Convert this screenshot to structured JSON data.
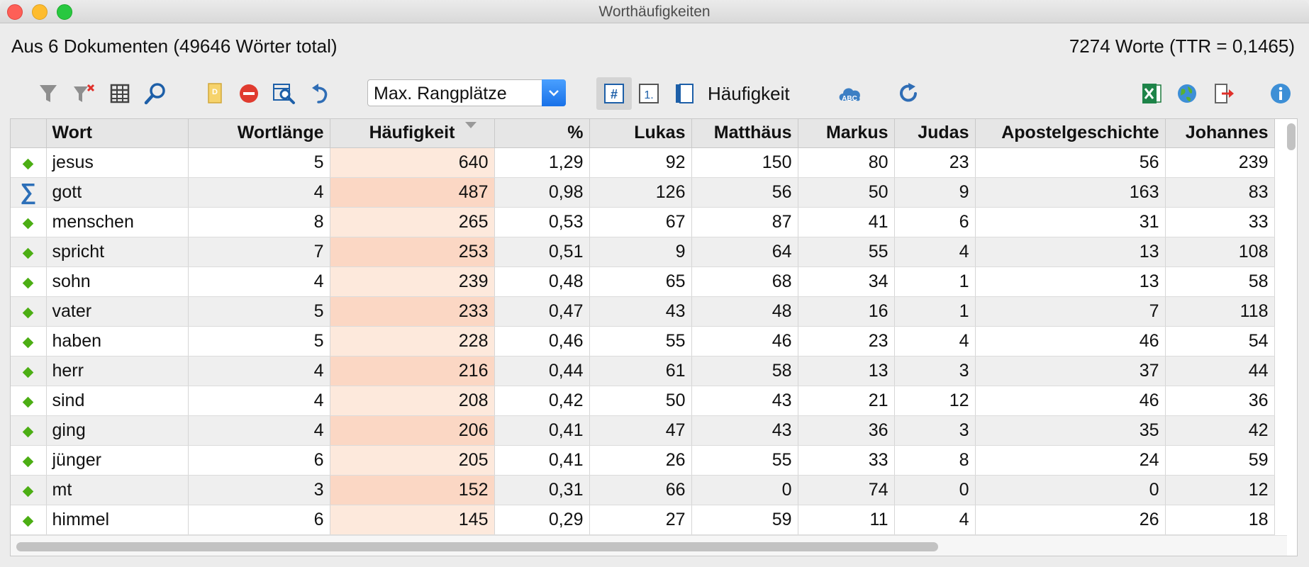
{
  "window": {
    "title": "Worthäufigkeiten"
  },
  "summary": {
    "documents": "Aus 6 Dokumenten (49646 Wörter total)",
    "words": "7274 Worte (TTR = 0,1465)"
  },
  "toolbar": {
    "left_icons": [
      "filter-icon",
      "clear-filter-icon",
      "columns-icon",
      "search-icon",
      "dictionary-icon",
      "stoplist-icon",
      "search-results-icon",
      "undo-icon"
    ],
    "rank_dropdown": {
      "selected": "Max. Rangplätze"
    },
    "view_icons": [
      "frequency-hash-icon",
      "rank-icon",
      "document-icon"
    ],
    "sort_label": "Häufigkeit",
    "right_icons": [
      "word-cloud-icon",
      "refresh-icon",
      "excel-export-icon",
      "web-export-icon",
      "export-icon",
      "info-icon"
    ]
  },
  "table": {
    "columns": [
      "Wort",
      "Wortlänge",
      "Häufigkeit",
      "%",
      "Lukas",
      "Matthäus",
      "Markus",
      "Judas",
      "Apostelgeschichte",
      "Johannes"
    ],
    "sorted_by": "Häufigkeit",
    "rows": [
      {
        "marker": "diamond",
        "cells": [
          "jesus",
          "5",
          "640",
          "1,29",
          "92",
          "150",
          "80",
          "23",
          "56",
          "239"
        ]
      },
      {
        "marker": "sigma",
        "cells": [
          "gott",
          "4",
          "487",
          "0,98",
          "126",
          "56",
          "50",
          "9",
          "163",
          "83"
        ]
      },
      {
        "marker": "diamond",
        "cells": [
          "menschen",
          "8",
          "265",
          "0,53",
          "67",
          "87",
          "41",
          "6",
          "31",
          "33"
        ]
      },
      {
        "marker": "diamond",
        "cells": [
          "spricht",
          "7",
          "253",
          "0,51",
          "9",
          "64",
          "55",
          "4",
          "13",
          "108"
        ]
      },
      {
        "marker": "diamond",
        "cells": [
          "sohn",
          "4",
          "239",
          "0,48",
          "65",
          "68",
          "34",
          "1",
          "13",
          "58"
        ]
      },
      {
        "marker": "diamond",
        "cells": [
          "vater",
          "5",
          "233",
          "0,47",
          "43",
          "48",
          "16",
          "1",
          "7",
          "118"
        ]
      },
      {
        "marker": "diamond",
        "cells": [
          "haben",
          "5",
          "228",
          "0,46",
          "55",
          "46",
          "23",
          "4",
          "46",
          "54"
        ]
      },
      {
        "marker": "diamond",
        "cells": [
          "herr",
          "4",
          "216",
          "0,44",
          "61",
          "58",
          "13",
          "3",
          "37",
          "44"
        ]
      },
      {
        "marker": "diamond",
        "cells": [
          "sind",
          "4",
          "208",
          "0,42",
          "50",
          "43",
          "21",
          "12",
          "46",
          "36"
        ]
      },
      {
        "marker": "diamond",
        "cells": [
          "ging",
          "4",
          "206",
          "0,41",
          "47",
          "43",
          "36",
          "3",
          "35",
          "42"
        ]
      },
      {
        "marker": "diamond",
        "cells": [
          "jünger",
          "6",
          "205",
          "0,41",
          "26",
          "55",
          "33",
          "8",
          "24",
          "59"
        ]
      },
      {
        "marker": "diamond",
        "cells": [
          "mt",
          "3",
          "152",
          "0,31",
          "66",
          "0",
          "74",
          "0",
          "0",
          "12"
        ]
      },
      {
        "marker": "diamond",
        "cells": [
          "himmel",
          "6",
          "145",
          "0,29",
          "27",
          "59",
          "11",
          "4",
          "26",
          "18"
        ]
      }
    ]
  },
  "colors": {
    "frequency_highlight": "#fde9dc",
    "frequency_highlight_alt": "#fbd7c4",
    "marker_green": "#4cae14",
    "accent_blue": "#1871e8"
  }
}
